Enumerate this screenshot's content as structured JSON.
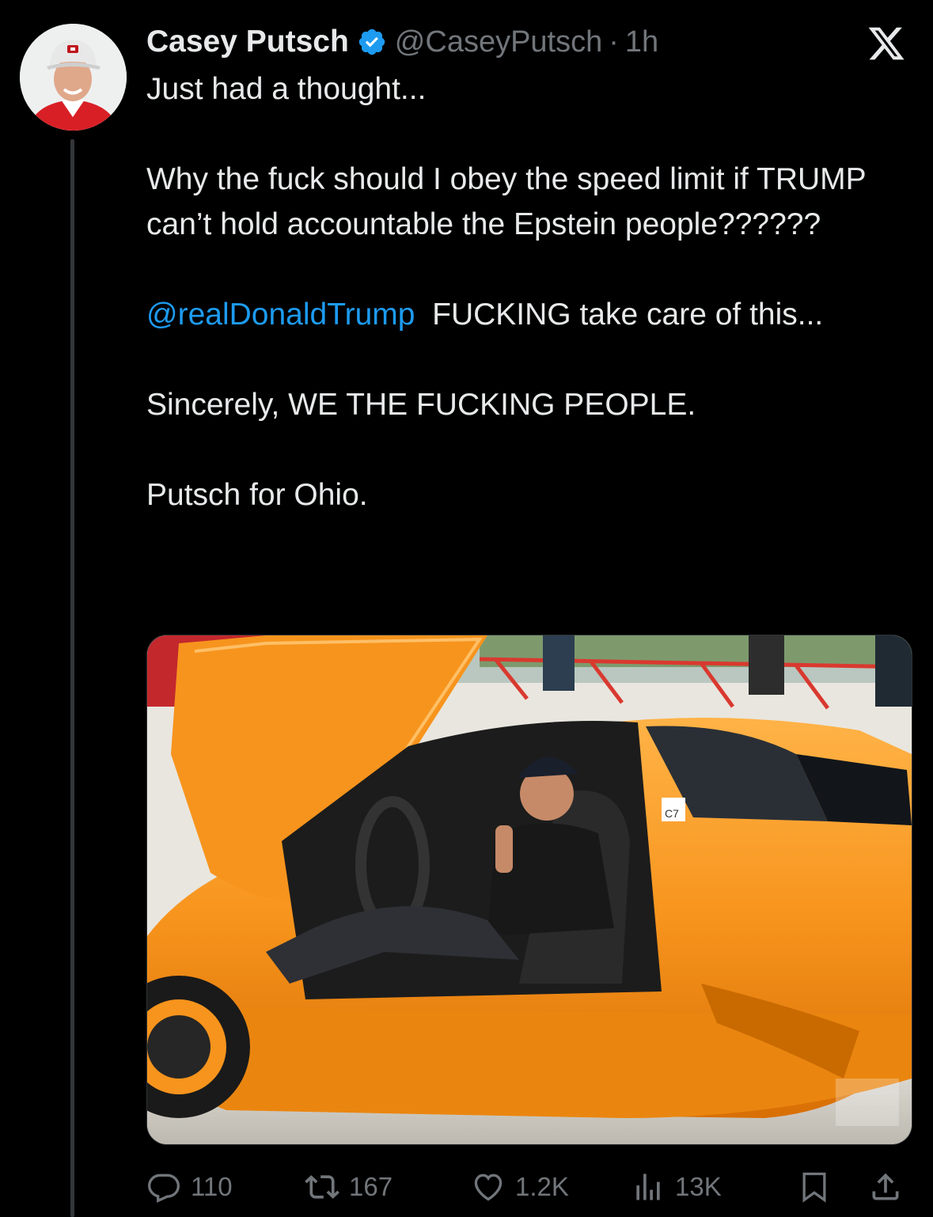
{
  "tweet": {
    "author_name": "Casey Putsch",
    "handle": "@CaseyPutsch",
    "separator": "·",
    "time": "1h",
    "lines": {
      "l1": "Just had a thought...",
      "l2": "Why the fuck should I obey the speed limit if TRUMP can’t hold accountable the Epstein people??????",
      "mention": "@realDonaldTrump",
      "l3_rest": "  FUCKING take care of this...",
      "l4": "Sincerely, WE THE FUCKING PEOPLE.",
      "l5": "Putsch for Ohio."
    },
    "media": {
      "alt_subject": "orange sports car with man in driver seat",
      "sticker_text": "C7"
    }
  },
  "actions": {
    "reply_count": "110",
    "retweet_count": "167",
    "like_count": "1.2K",
    "views_count": "13K"
  },
  "colors": {
    "accent": "#1d9bf0",
    "muted": "#71767b",
    "text": "#e7e9ea",
    "car": "#f7941d"
  },
  "icons": [
    "verified-badge-icon",
    "x-logo-icon",
    "reply-icon",
    "retweet-icon",
    "like-icon",
    "views-icon",
    "bookmark-icon",
    "share-icon"
  ]
}
